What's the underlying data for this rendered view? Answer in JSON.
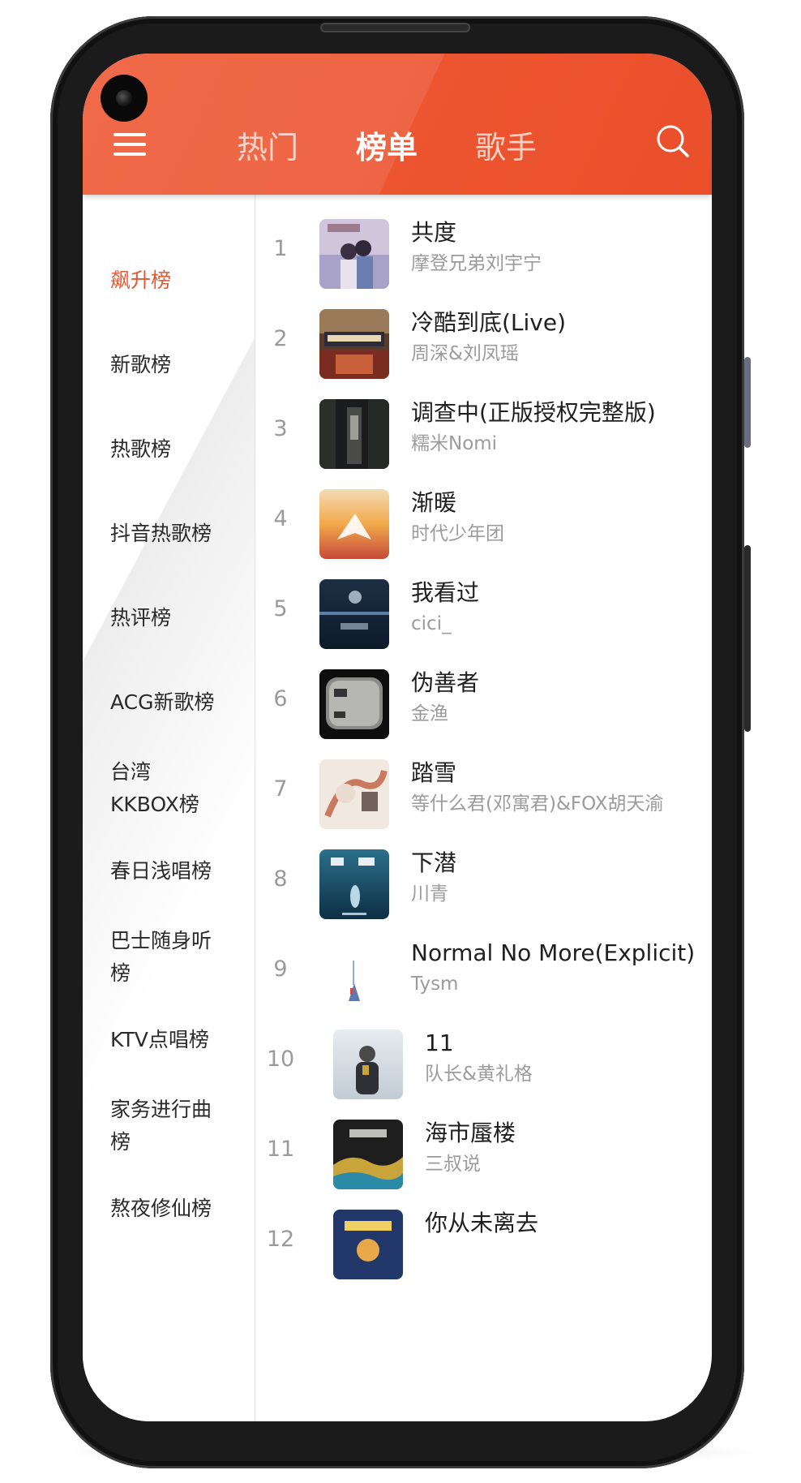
{
  "header": {
    "tabs": [
      {
        "label": "热门",
        "active": false
      },
      {
        "label": "榜单",
        "active": true
      },
      {
        "label": "歌手",
        "active": false
      }
    ],
    "menu_icon": "hamburger-menu-icon",
    "search_icon": "search-icon",
    "accent_color": "#ec5a33"
  },
  "sidebar": {
    "items": [
      {
        "label": "飙升榜",
        "active": true
      },
      {
        "label": "新歌榜"
      },
      {
        "label": "热歌榜"
      },
      {
        "label": "抖音热歌榜"
      },
      {
        "label": "热评榜"
      },
      {
        "label": "ACG新歌榜"
      },
      {
        "label": "台湾\nKKBOX榜"
      },
      {
        "label": "春日浅唱榜"
      },
      {
        "label": "巴士随身听\n榜"
      },
      {
        "label": "KTV点唱榜"
      },
      {
        "label": "家务进行曲\n榜"
      },
      {
        "label": "熬夜修仙榜"
      }
    ]
  },
  "songs": [
    {
      "rank": "1",
      "title": "共度",
      "artist": "摩登兄弟刘宇宁"
    },
    {
      "rank": "2",
      "title": "冷酷到底(Live)",
      "artist": "周深&刘凤瑶"
    },
    {
      "rank": "3",
      "title": "调查中(正版授权完整版)",
      "artist": "糯米Nomi"
    },
    {
      "rank": "4",
      "title": "渐暖",
      "artist": "时代少年团"
    },
    {
      "rank": "5",
      "title": "我看过",
      "artist": "cici_"
    },
    {
      "rank": "6",
      "title": "伪善者",
      "artist": "金渔"
    },
    {
      "rank": "7",
      "title": "踏雪",
      "artist": "等什么君(邓寓君)&FOX胡天渝"
    },
    {
      "rank": "8",
      "title": "下潜",
      "artist": "川青"
    },
    {
      "rank": "9",
      "title": "Normal No More(Explicit)",
      "artist": "Tysm"
    },
    {
      "rank": "10",
      "title": "11",
      "artist": "队长&黄礼格"
    },
    {
      "rank": "11",
      "title": "海市蜃楼",
      "artist": "三叔说"
    },
    {
      "rank": "12",
      "title": "你从未离去",
      "artist": ""
    }
  ]
}
